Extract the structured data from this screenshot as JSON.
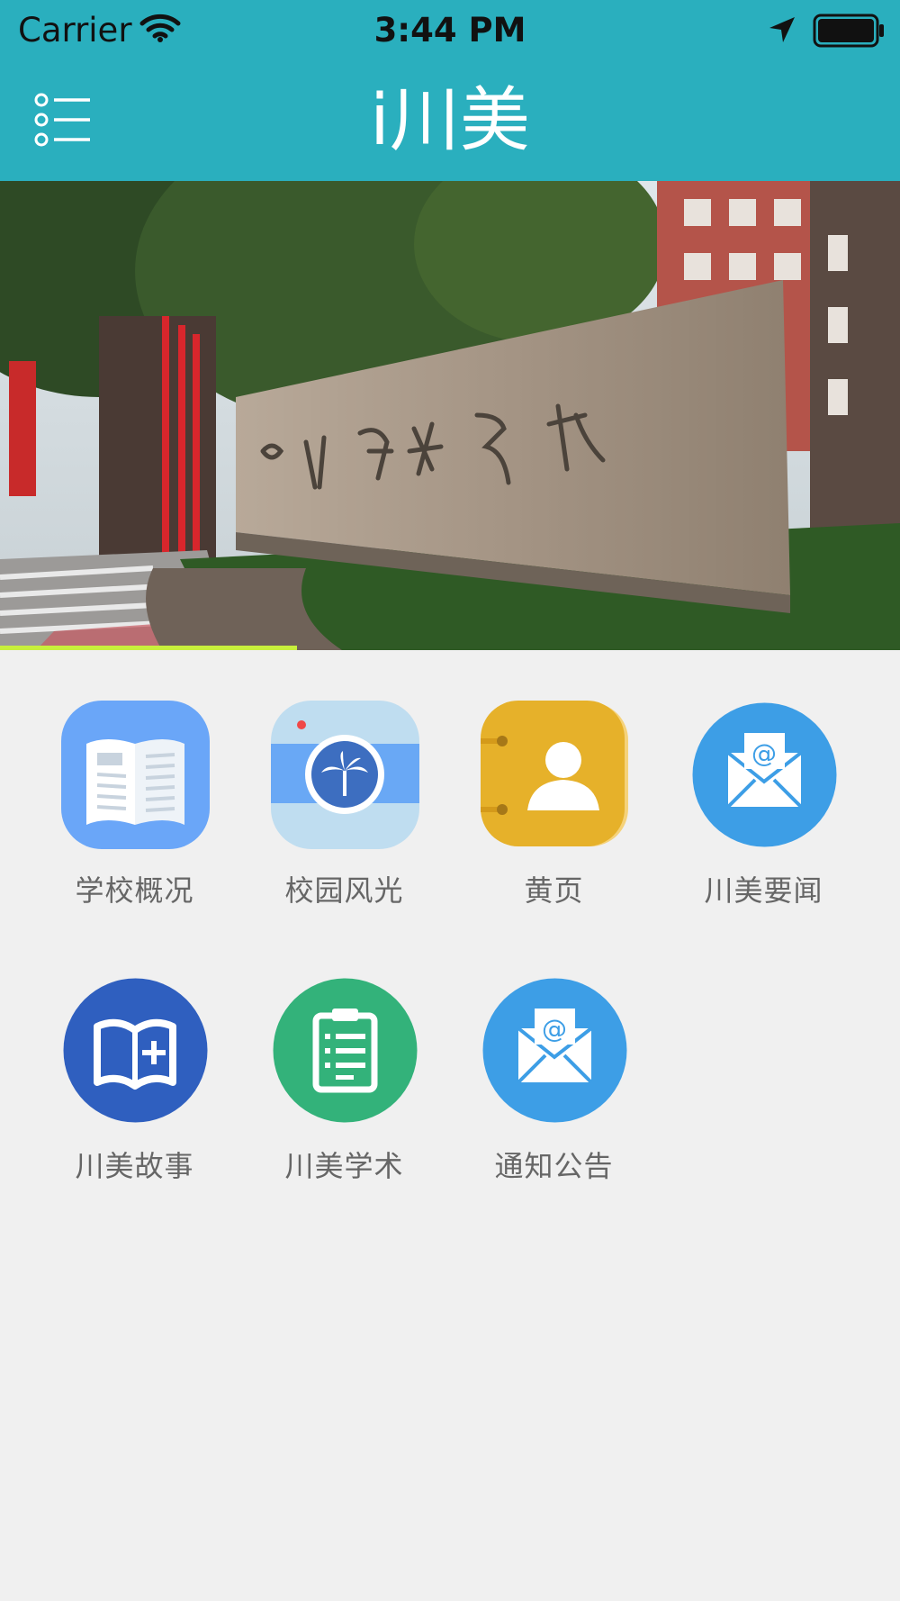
{
  "status_bar": {
    "carrier": "Carrier",
    "time": "3:44 PM",
    "icons": [
      "wifi-icon",
      "location-arrow-icon",
      "battery-icon"
    ]
  },
  "nav": {
    "title": "i川美",
    "menu_icon": "list-menu-icon"
  },
  "banner": {
    "image": "campus-gate-stone-photo",
    "progress": 0.33
  },
  "grid": {
    "items": [
      {
        "label": "学校概况",
        "icon": "open-book-icon",
        "color": "#6aa6f8"
      },
      {
        "label": "校园风光",
        "icon": "camera-palm-icon",
        "color": "#bfddf0"
      },
      {
        "label": "黄页",
        "icon": "contacts-book-icon",
        "color": "#e6b12a"
      },
      {
        "label": "川美要闻",
        "icon": "mail-at-icon",
        "color": "#3d9ee6"
      },
      {
        "label": "川美故事",
        "icon": "book-plus-icon",
        "color": "#2f5fbf"
      },
      {
        "label": "川美学术",
        "icon": "clipboard-icon",
        "color": "#33b27a"
      },
      {
        "label": "通知公告",
        "icon": "mail-at-icon",
        "color": "#3d9ee6"
      }
    ]
  },
  "colors": {
    "theme": "#2aafbe",
    "background": "#f0f0f0",
    "progress": "#c8f03c"
  }
}
